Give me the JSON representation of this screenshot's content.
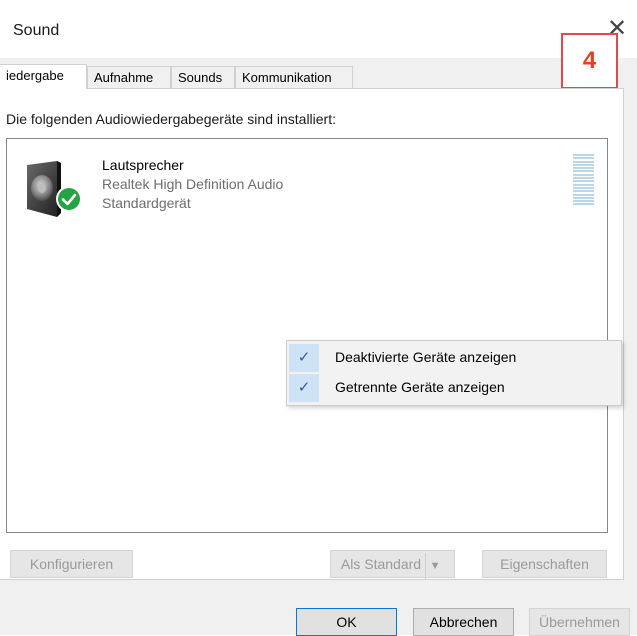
{
  "window": {
    "title": "Sound",
    "close_glyph": "✕"
  },
  "annotation": {
    "text": "4",
    "color": "#e24a4a"
  },
  "tabs": [
    {
      "label": "iedergabe",
      "active": true
    },
    {
      "label": "Aufnahme",
      "active": false
    },
    {
      "label": "Sounds",
      "active": false
    },
    {
      "label": "Kommunikation",
      "active": false
    }
  ],
  "intro_text": "Die folgenden Audiowiedergabegeräte sind installiert:",
  "device": {
    "name": "Lautsprecher",
    "driver": "Realtek High Definition Audio",
    "status": "Standardgerät",
    "icon": "speaker-icon",
    "badge_icon": "default-check-icon"
  },
  "context_menu": {
    "items": [
      {
        "label": "Deaktivierte Geräte anzeigen",
        "checked": true
      },
      {
        "label": "Getrennte Geräte anzeigen",
        "checked": true
      }
    ],
    "check_glyph": "✓"
  },
  "buttons": {
    "configure": "Konfigurieren",
    "set_default": "Als Standard",
    "set_default_arrow": "▼",
    "properties": "Eigenschaften",
    "ok": "OK",
    "cancel": "Abbrechen",
    "apply": "Übernehmen"
  },
  "colors": {
    "accent": "#0078d7",
    "check_bg": "#cfe3f7",
    "badge_green": "#26a445"
  }
}
